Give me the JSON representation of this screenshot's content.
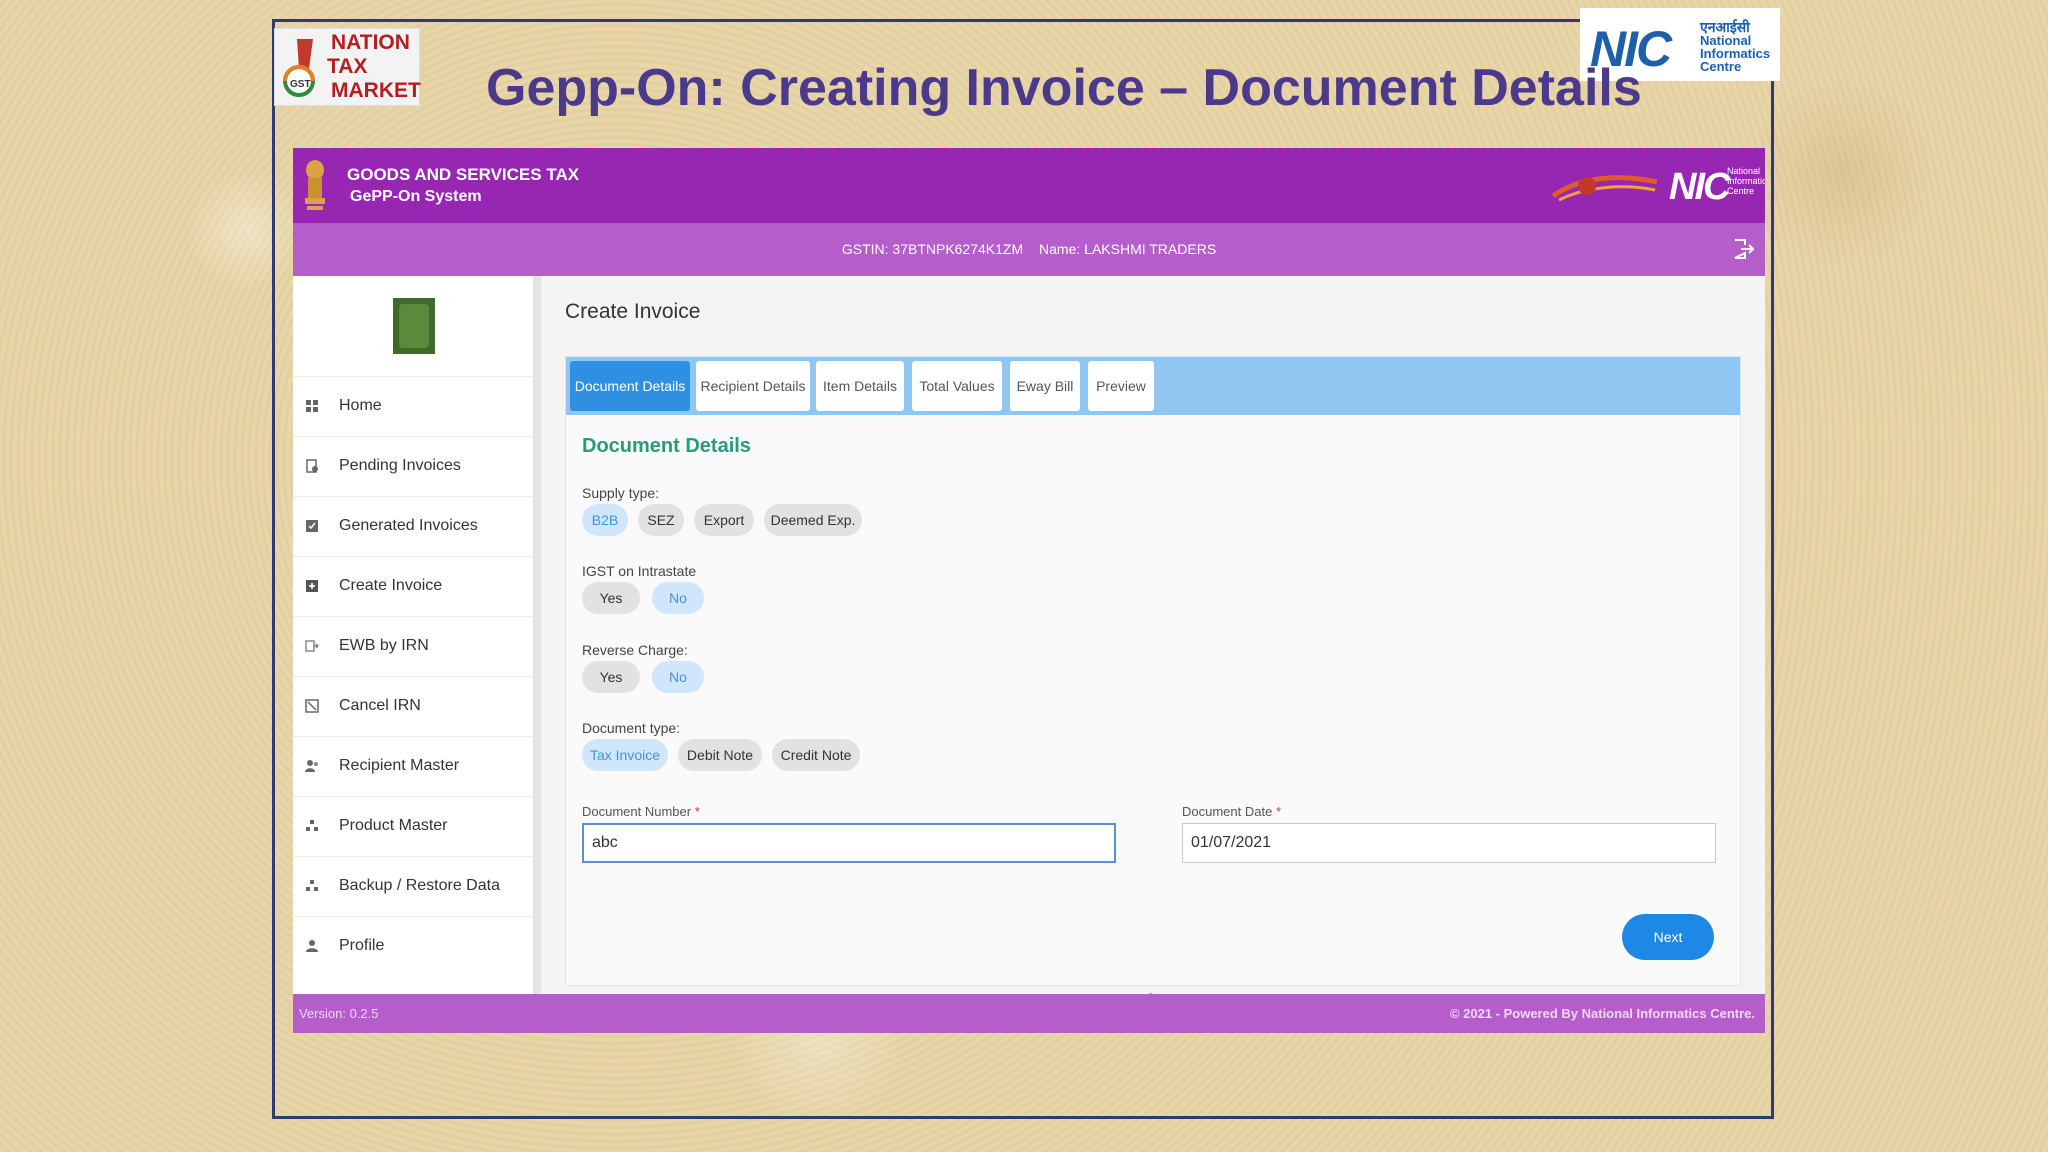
{
  "slide": {
    "title": "Gepp-On: Creating Invoice – Document Details",
    "logo_left_lines": [
      "NATION",
      "TAX",
      "MARKET"
    ],
    "logo_left_badge": "GST",
    "logo_right_main": "NIC",
    "logo_right_hindi": "एनआईसी",
    "logo_right_sub": "National Informatics Centre"
  },
  "app": {
    "header": {
      "title": "GOODS AND SERVICES TAX",
      "subtitle": "GePP-On System",
      "nic_text": "NIC"
    },
    "subbar": {
      "gstin": "GSTIN: 37BTNPK6274K1ZM",
      "name": "Name: LAKSHMI TRADERS"
    },
    "sidebar": {
      "items": [
        {
          "label": "Home",
          "icon": "home-icon"
        },
        {
          "label": "Pending Invoices",
          "icon": "pending-icon"
        },
        {
          "label": "Generated Invoices",
          "icon": "generated-icon"
        },
        {
          "label": "Create Invoice",
          "icon": "create-icon"
        },
        {
          "label": "EWB by IRN",
          "icon": "ewb-icon"
        },
        {
          "label": "Cancel IRN",
          "icon": "cancel-icon"
        },
        {
          "label": "Recipient Master",
          "icon": "recipient-icon"
        },
        {
          "label": "Product Master",
          "icon": "product-icon"
        },
        {
          "label": "Backup / Restore Data",
          "icon": "backup-icon"
        },
        {
          "label": "Profile",
          "icon": "profile-icon"
        }
      ]
    },
    "main": {
      "page_title": "Create Invoice",
      "tabs": [
        {
          "label": "Document Details",
          "active": true
        },
        {
          "label": "Recipient Details",
          "active": false
        },
        {
          "label": "Item Details",
          "active": false
        },
        {
          "label": "Total Values",
          "active": false
        },
        {
          "label": "Eway Bill",
          "active": false
        },
        {
          "label": "Preview",
          "active": false
        }
      ],
      "section_title": "Document Details",
      "supply_type": {
        "label": "Supply type:",
        "options": [
          "B2B",
          "SEZ",
          "Export",
          "Deemed Exp."
        ],
        "selected": "B2B"
      },
      "igst": {
        "label": "IGST on Intrastate",
        "options": [
          "Yes",
          "No"
        ],
        "selected": "No"
      },
      "reverse_charge": {
        "label": "Reverse Charge:",
        "options": [
          "Yes",
          "No"
        ],
        "selected": "No"
      },
      "document_type": {
        "label": "Document type:",
        "options": [
          "Tax Invoice",
          "Debit Note",
          "Credit Note"
        ],
        "selected": "Tax Invoice"
      },
      "document_number": {
        "label": "Document Number",
        "required_mark": "*",
        "value": "abc"
      },
      "document_date": {
        "label": "Document Date",
        "required_mark": "*",
        "value": "01/07/2021"
      },
      "next_label": "Next"
    },
    "footer": {
      "version": "Version: 0.2.5",
      "copyright": "© 2021 - Powered By National Informatics Centre."
    }
  },
  "colors": {
    "header_purple": "#9726b3",
    "subbar_purple": "#b65dcc",
    "title_purple": "#4b3a8a",
    "tab_active": "#2f8fe0",
    "section_green": "#2a9a7a",
    "next_button": "#1e88e5"
  }
}
